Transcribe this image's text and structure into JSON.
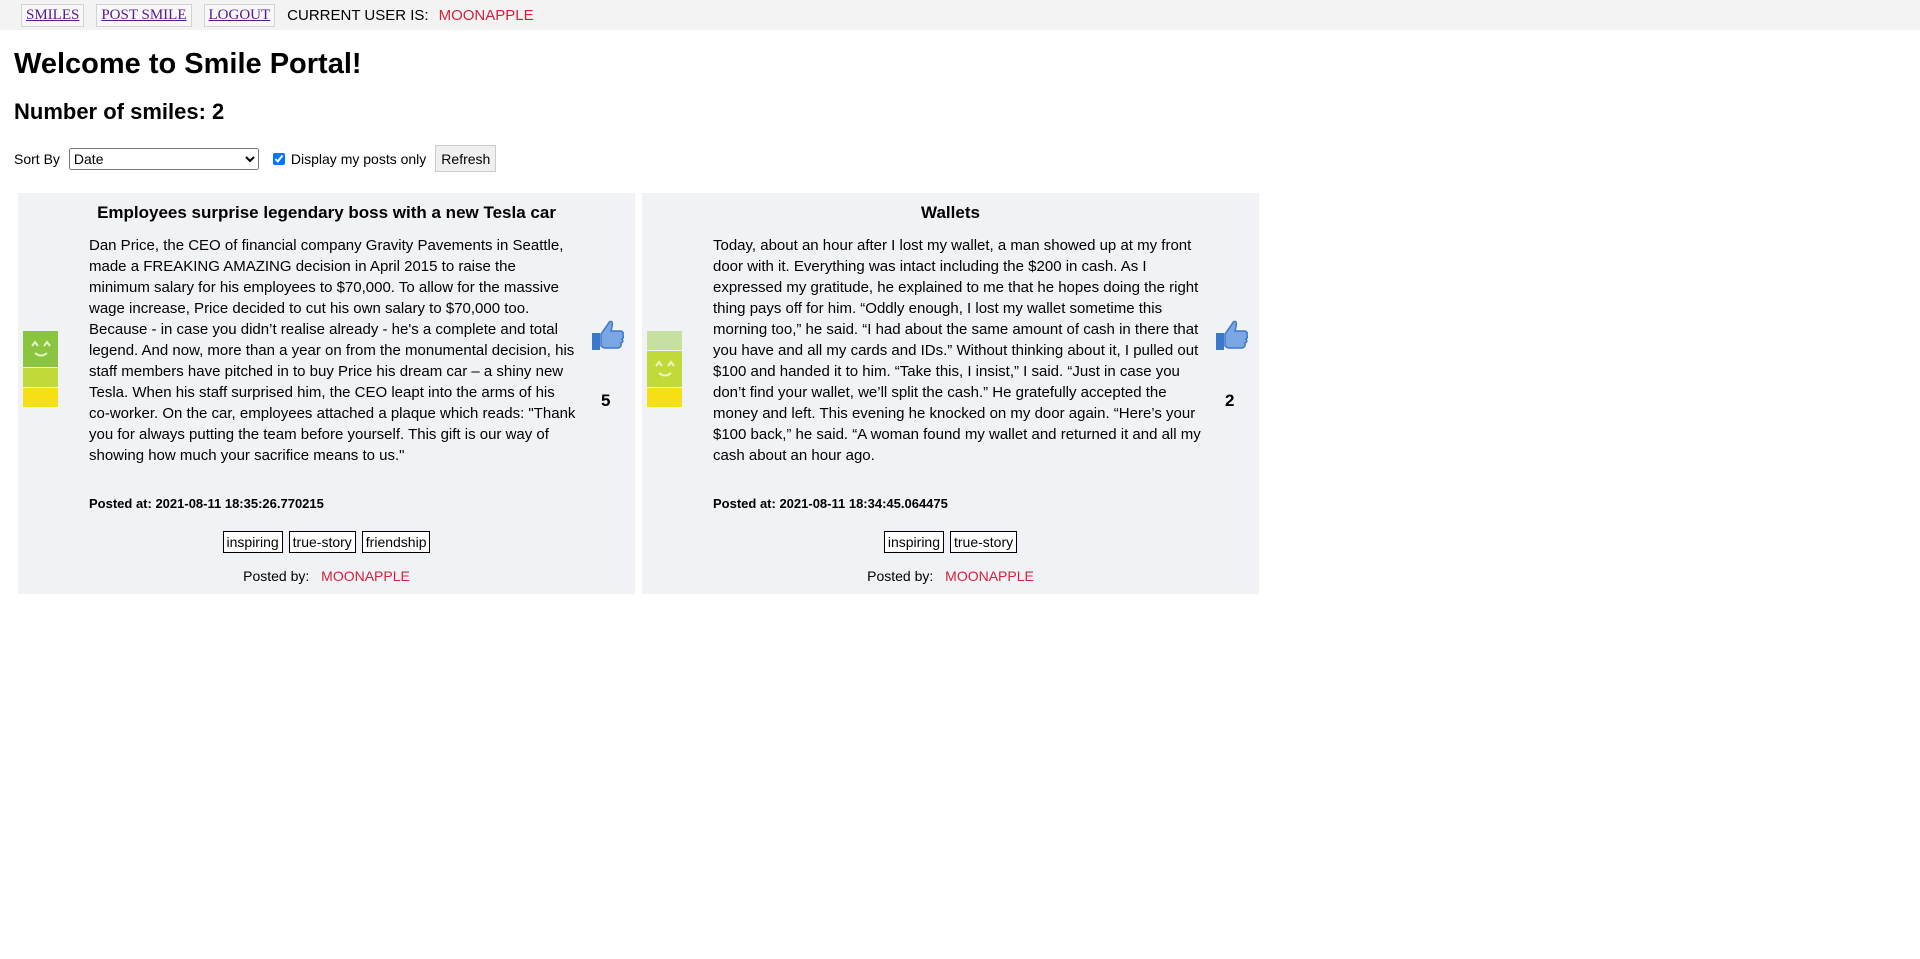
{
  "nav": {
    "smiles": "SMILES",
    "post_smile": "POST SMILE",
    "logout": "LOGOUT",
    "current_user_label": "CURRENT USER IS:",
    "current_user": "MOONAPPLE"
  },
  "heading": "Welcome to Smile Portal!",
  "count_text": "Number of smiles: 2",
  "controls": {
    "sort_label": "Sort By",
    "sort_value": "Date",
    "display_mine_label": "Display my posts only",
    "display_mine_checked": true,
    "refresh": "Refresh"
  },
  "posts": [
    {
      "title": "Employees surprise legendary boss with a new Tesla car",
      "body": "Dan Price, the CEO of financial company Gravity Pavements in Seattle, made a FREAKING AMAZING decision in April 2015 to raise the minimum salary for his employees to $70,000. To allow for the massive wage increase, Price decided to cut his own salary to $70,000 too. Because - in case you didn’t realise already - he's a complete and total legend. And now, more than a year on from the monumental decision, his staff members have pitched in to buy Price his dream car – a shiny new Tesla. When his staff surprised him, the CEO leapt into the arms of his co-worker. On the car, employees attached a plaque which reads: \"Thank you for always putting the team before yourself. This gift is our way of showing how much your sacrifice means to us.\"",
      "posted_at": "Posted at: 2021-08-11 18:35:26.770215",
      "tags": [
        "inspiring",
        "true-story",
        "friendship"
      ],
      "posted_by_label": "Posted by:",
      "posted_by": "MOONAPPLE",
      "likes": "5",
      "happiness_level": 3
    },
    {
      "title": "Wallets",
      "body": "Today, about an hour after I lost my wallet, a man showed up at my front door with it. Everything was intact including the $200 in cash. As I expressed my gratitude, he explained to me that he hopes doing the right thing pays off for him. “Oddly enough, I lost my wallet sometime this morning too,” he said. “I had about the same amount of cash in there that you have and all my cards and IDs.” Without thinking about it, I pulled out $100 and handed it to him. “Take this, I insist,” I said. “Just in case you don’t find your wallet, we’ll split the cash.” He gratefully accepted the money and left. This evening he knocked on my door again. “Here’s your $100 back,” he said. “A woman found my wallet and returned it and all my cash about an hour ago.",
      "posted_at": "Posted at: 2021-08-11 18:34:45.064475",
      "tags": [
        "inspiring",
        "true-story"
      ],
      "posted_by_label": "Posted by:",
      "posted_by": "MOONAPPLE",
      "likes": "2",
      "happiness_level": 2
    }
  ],
  "colors": {
    "username": "#d0223d",
    "card_bg": "#f1f2f6",
    "meter_green": "#8bc43f",
    "meter_lightgreen": "#c5e0a0",
    "meter_yellowgreen": "#c2d93a",
    "meter_yellow": "#f5e018",
    "like_blue": "#3a78c9"
  },
  "icons": {
    "like": "thumbs-up-icon",
    "meter_face": "smile-face-icon"
  }
}
